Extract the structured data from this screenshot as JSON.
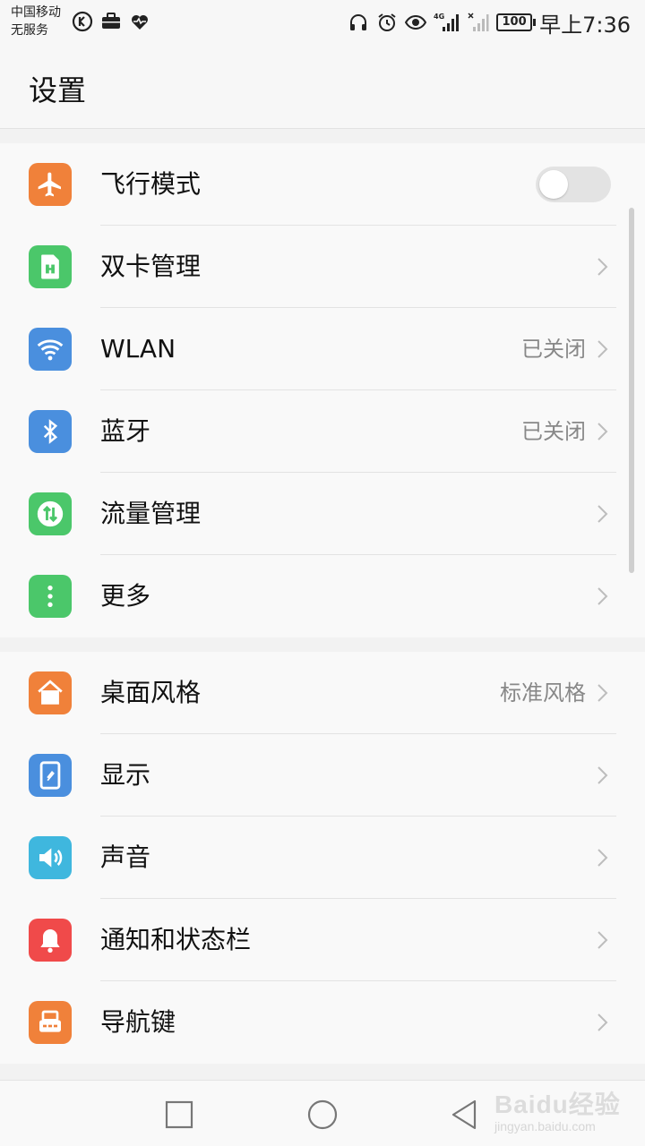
{
  "status_bar": {
    "carrier_line1": "中国移动",
    "carrier_line2": "无服务",
    "network": "4G",
    "battery": "100",
    "time": "早上7:36",
    "left_icons": [
      "k-icon",
      "briefcase-icon",
      "heart-rate-icon"
    ],
    "right_icons": [
      "headset-icon",
      "alarm-icon",
      "eye-icon",
      "signal-icon",
      "signal-none-icon",
      "battery-icon"
    ]
  },
  "header": {
    "title": "设置"
  },
  "groups": [
    {
      "items": [
        {
          "label": "飞行模式",
          "icon": "airplane-icon",
          "color": "#f0813a",
          "control": "toggle",
          "toggle_on": false
        },
        {
          "label": "双卡管理",
          "icon": "sim-card-icon",
          "color": "#4bc76a",
          "control": "chevron"
        },
        {
          "label": "WLAN",
          "icon": "wifi-icon",
          "color": "#4a8fde",
          "value": "已关闭",
          "control": "chevron"
        },
        {
          "label": "蓝牙",
          "icon": "bluetooth-icon",
          "color": "#4a8fde",
          "value": "已关闭",
          "control": "chevron"
        },
        {
          "label": "流量管理",
          "icon": "data-usage-icon",
          "color": "#4bc76a",
          "control": "chevron"
        },
        {
          "label": "更多",
          "icon": "more-vertical-icon",
          "color": "#4bc76a",
          "control": "chevron"
        }
      ]
    },
    {
      "items": [
        {
          "label": "桌面风格",
          "icon": "home-icon",
          "color": "#f0813a",
          "value": "标准风格",
          "control": "chevron"
        },
        {
          "label": "显示",
          "icon": "display-icon",
          "color": "#4a8fde",
          "control": "chevron"
        },
        {
          "label": "声音",
          "icon": "sound-icon",
          "color": "#3fb7de",
          "control": "chevron"
        },
        {
          "label": "通知和状态栏",
          "icon": "bell-icon",
          "color": "#f04a4a",
          "control": "chevron"
        },
        {
          "label": "导航键",
          "icon": "navigation-keys-icon",
          "color": "#f0813a",
          "control": "chevron"
        }
      ]
    }
  ],
  "nav_bar": {
    "buttons": [
      "recent-apps-button",
      "home-button",
      "back-button"
    ]
  },
  "watermark": {
    "main": "Baidu经验",
    "sub": "jingyan.baidu.com"
  }
}
